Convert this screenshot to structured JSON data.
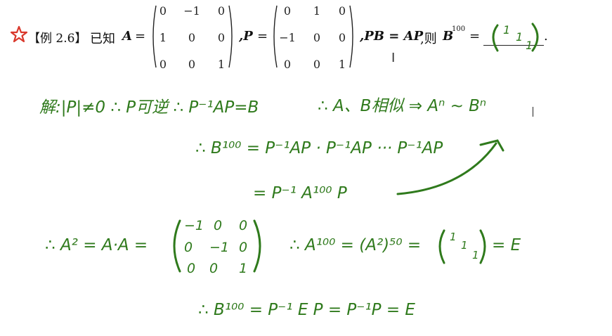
{
  "problem": {
    "label": "【例 2.6】",
    "known": "已知",
    "A_label": "A",
    "equals": "=",
    "comma_P": ",P",
    "pb_ap": ",PB = AP",
    "then": ",则",
    "B_label": "B",
    "B_exponent": "100",
    "end_period": ".",
    "A_matrix": [
      [
        "0",
        "−1",
        "0"
      ],
      [
        "1",
        "0",
        "0"
      ],
      [
        "0",
        "0",
        "1"
      ]
    ],
    "P_matrix": [
      [
        "0",
        "1",
        "0"
      ],
      [
        "−1",
        "0",
        "0"
      ],
      [
        "0",
        "0",
        "1"
      ]
    ]
  },
  "answer_blank": {
    "cells": [
      "1",
      "1",
      "1"
    ]
  },
  "handwriting": {
    "line1_part1": "解:|P|≠0 ∴ P可逆 ∴ P⁻¹AP=B",
    "line1_part2": "∴ A、B相似 ⇒ Aⁿ ~ Bⁿ",
    "line2": "∴ B¹⁰⁰ = P⁻¹AP · P⁻¹AP ··· P⁻¹AP",
    "line3": "= P⁻¹ A¹⁰⁰ P",
    "line4_left": "∴ A² = A·A =",
    "A2_matrix": [
      [
        "−1",
        "0",
        "0"
      ],
      [
        "0",
        "−1",
        "0"
      ],
      [
        "0",
        "0",
        "1"
      ]
    ],
    "line4_right": "∴ A¹⁰⁰ = (A²)⁵⁰ =",
    "line4_mat": [
      "1",
      "1",
      "1"
    ],
    "line4_end": "= E",
    "line5": "∴ B¹⁰⁰ = P⁻¹ E P = P⁻¹P = E"
  },
  "colors": {
    "ink_green": "#2f7a1c",
    "star_red": "#d9382c",
    "text": "#111111"
  }
}
